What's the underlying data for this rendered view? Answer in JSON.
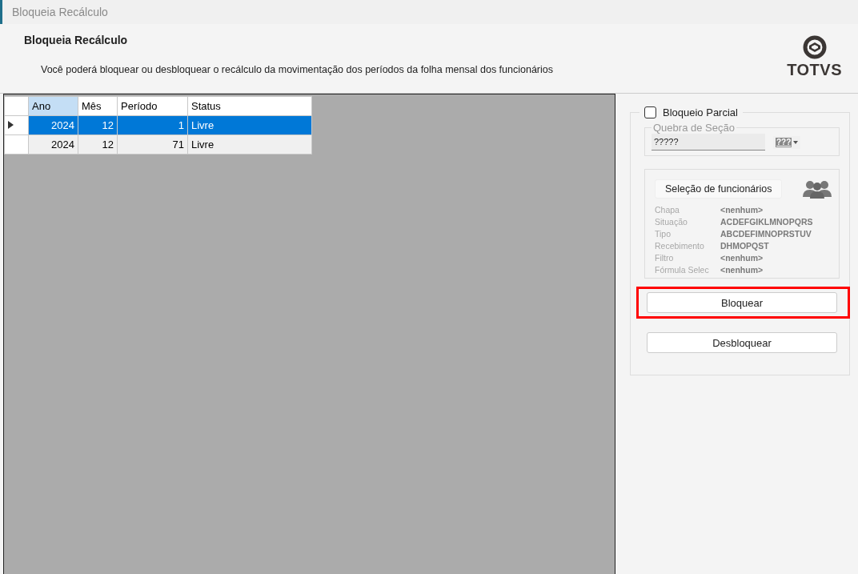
{
  "window": {
    "title": "Bloqueia Recálculo"
  },
  "header": {
    "title": "Bloqueia Recálculo",
    "description": "Você poderá bloquear ou desbloquear o recálculo da movimentação dos períodos da folha mensal dos funcionários",
    "logo": "TOTVS"
  },
  "table": {
    "columns": [
      "Ano",
      "Mês",
      "Período",
      "Status"
    ],
    "rows": [
      {
        "cells": [
          "2024",
          "12",
          "1",
          "Livre"
        ],
        "selected": true
      },
      {
        "cells": [
          "2024",
          "12",
          "71",
          "Livre"
        ],
        "selected": false
      }
    ]
  },
  "partial_block": {
    "label": "Bloqueio Parcial",
    "checked": false
  },
  "section_break": {
    "legend": "Quebra de Seção",
    "value": "?????",
    "picker_text": "???"
  },
  "employee_selection": {
    "button": "Seleção de funcionários",
    "filters": [
      {
        "label": "Chapa",
        "value": "<nenhum>"
      },
      {
        "label": "Situação",
        "value": "ACDEFGIKLMNOPQRS"
      },
      {
        "label": "Tipo",
        "value": "ABCDEFIMNOPRSTUV"
      },
      {
        "label": "Recebimento",
        "value": "DHMOPQST"
      },
      {
        "label": "Filtro",
        "value": "<nenhum>"
      },
      {
        "label": "Fórmula Selec",
        "value": "<nenhum>"
      }
    ]
  },
  "buttons": [
    {
      "label": "Bloquear",
      "highlighted": true
    },
    {
      "label": "Desbloquear",
      "highlighted": false
    }
  ]
}
